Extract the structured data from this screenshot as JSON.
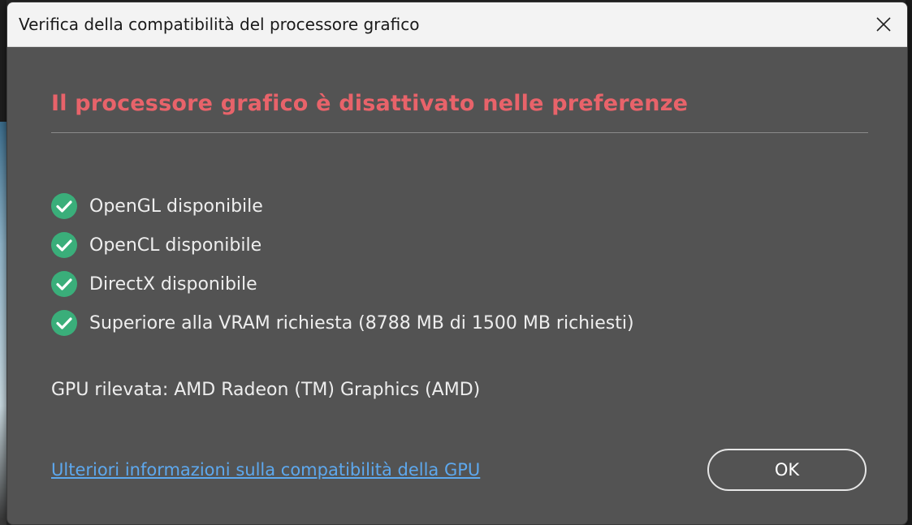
{
  "window": {
    "title": "Verifica della compatibilità del processore grafico",
    "close_icon": "close-icon"
  },
  "dialog": {
    "headline": "Il processore grafico è disattivato nelle preferenze",
    "headline_color": "#e8636a",
    "checks": [
      {
        "label": "OpenGL disponibile",
        "icon": "check-circle-icon",
        "status": "ok"
      },
      {
        "label": "OpenCL disponibile",
        "icon": "check-circle-icon",
        "status": "ok"
      },
      {
        "label": "DirectX disponibile",
        "icon": "check-circle-icon",
        "status": "ok"
      },
      {
        "label": "Superiore alla VRAM richiesta (8788 MB di 1500 MB richiesti)",
        "icon": "check-circle-icon",
        "status": "ok"
      }
    ],
    "check_color": "#3aae7a",
    "gpu_detected": "GPU rilevata: AMD Radeon (TM) Graphics (AMD)",
    "help_link": "Ulteriori informazioni sulla compatibilità della GPU",
    "ok_label": "OK"
  }
}
